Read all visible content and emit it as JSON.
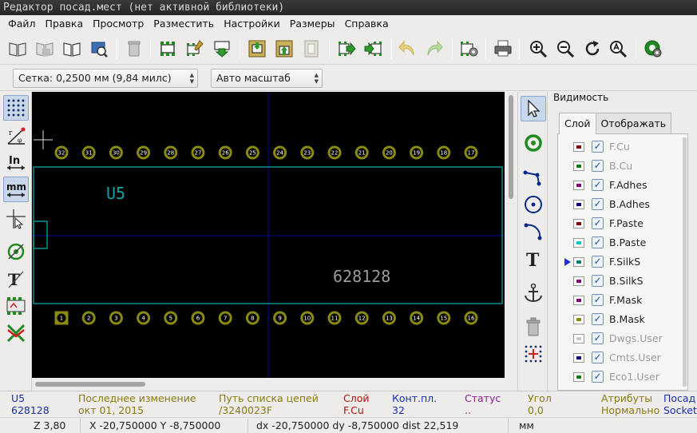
{
  "window": {
    "title": "Редактор посад.мест (нет активной библиотеки)"
  },
  "menu": [
    "Файл",
    "Правка",
    "Просмотр",
    "Разместить",
    "Настройки",
    "Размеры",
    "Справка"
  ],
  "toolbar": {
    "icons": [
      "select-active-library-icon",
      "save-library-icon",
      "library-browser-icon",
      "footprint-viewer-icon",
      "delete-icon",
      "new-footprint-icon",
      "footprint-wizard-icon",
      "load-footprint-icon",
      "load-from-board-icon",
      "insert-into-board-icon",
      "update-board-icon",
      "export-footprint-icon",
      "import-footprint-icon",
      "undo-icon",
      "redo-icon",
      "footprint-properties-icon",
      "print-icon",
      "zoom-in-icon",
      "zoom-out-icon",
      "redraw-icon",
      "zoom-auto-icon",
      "check-footprint-icon"
    ]
  },
  "aux": {
    "grid": "Сетка: 0,2500 мм (9,84 милс)",
    "zoom": "Авто масштаб"
  },
  "left_toolbar": [
    "grid-toggle-icon",
    "polar-coords-icon",
    "inch-units-icon",
    "mm-units-icon",
    "full-cursor-icon",
    "pad-sketch-icon",
    "text-sketch-icon",
    "edge-sketch-icon",
    "high-contrast-icon"
  ],
  "right_toolbar": [
    "select-tool-icon",
    "add-pad-icon",
    "add-line-icon",
    "add-circle-icon",
    "add-arc-icon",
    "add-text-icon",
    "anchor-icon",
    "delete-tool-icon",
    "grid-origin-icon"
  ],
  "canvas": {
    "reference": "U5",
    "value": "628128",
    "top_pads": [
      "32",
      "31",
      "30",
      "29",
      "28",
      "27",
      "26",
      "25",
      "24",
      "23",
      "22",
      "21",
      "20",
      "19",
      "18",
      "17"
    ],
    "bottom_pads": [
      "1",
      "2",
      "3",
      "4",
      "5",
      "6",
      "7",
      "8",
      "9",
      "10",
      "11",
      "12",
      "13",
      "14",
      "15",
      "16"
    ],
    "pad_color": "#8a8a12",
    "outline_color": "#0f8f8f",
    "axis_color": "#0a0a9a"
  },
  "panel": {
    "title": "Видимость",
    "tabs": [
      "Слой",
      "Отображать"
    ],
    "layers": [
      {
        "name": "F.Cu",
        "color": "#8b0000",
        "dim": true
      },
      {
        "name": "B.Cu",
        "color": "#0a7a0a",
        "dim": true
      },
      {
        "name": "F.Adhes",
        "color": "#800080",
        "dim": false
      },
      {
        "name": "B.Adhes",
        "color": "#00008b",
        "dim": false
      },
      {
        "name": "F.Paste",
        "color": "#8b0000",
        "dim": false
      },
      {
        "name": "B.Paste",
        "color": "#00c8c8",
        "dim": false
      },
      {
        "name": "F.SilkS",
        "color": "#008080",
        "dim": false,
        "active": true
      },
      {
        "name": "B.SilkS",
        "color": "#800080",
        "dim": false
      },
      {
        "name": "F.Mask",
        "color": "#800080",
        "dim": false
      },
      {
        "name": "B.Mask",
        "color": "#8a8a10",
        "dim": false
      },
      {
        "name": "Dwgs.User",
        "color": "#c8c8c8",
        "dim": true
      },
      {
        "name": "Cmts.User",
        "color": "#00008b",
        "dim": true
      },
      {
        "name": "Eco1.User",
        "color": "#0a7a0a",
        "dim": true
      }
    ]
  },
  "status": [
    {
      "label": "U5",
      "value": "628128",
      "color": "#1a2fa8"
    },
    {
      "label": "Последнее изменение",
      "value": "окт 01, 2015",
      "color": "#8a7a10"
    },
    {
      "label": "Путь списка цепей",
      "value": "/3240023F",
      "color": "#8a7a10"
    },
    {
      "label": "Слой",
      "value": "F.Cu",
      "color": "#b01010"
    },
    {
      "label": "Конт.пл.",
      "value": "32",
      "color": "#1a2fa8"
    },
    {
      "label": "Статус",
      "value": "..",
      "color": "#8a2090"
    },
    {
      "label": "Угол",
      "value": "0,0",
      "color": "#8a7a10"
    },
    {
      "label": "Атрибуты",
      "value": "Нормально",
      "color": "#8a7a10"
    },
    {
      "label": "Посад",
      "value": "Socket",
      "color": "#1a2fa8"
    }
  ],
  "coords": {
    "zoom": "Z 3,80",
    "abs": "X -20,750000  Y -8,750000",
    "rel": "dx -20,750000  dy -8,750000  dist 22,519",
    "units": "мм"
  }
}
